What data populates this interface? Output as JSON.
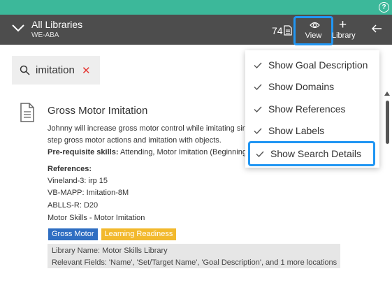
{
  "header": {
    "library_title": "All Libraries",
    "library_subtitle": "WE-ABA",
    "count": "74",
    "view_label": "View",
    "add_label": "Library"
  },
  "search": {
    "value": "imitation"
  },
  "item": {
    "title": "Gross Motor Imitation",
    "description_line1": "Johnny will increase gross motor control while imitating single-",
    "description_line2": "step gross motor actions and imitation with objects.",
    "prereq_label": "Pre-requisite skills:",
    "prereq_value": "Attending, Motor Imitation (Beginning)",
    "references_label": "References:",
    "references": [
      "Vineland-3: irp 15",
      "VB-MAPP: Imitation-8M",
      "ABLLS-R:  D20",
      "Motor Skills - Motor Imitation"
    ],
    "tags": [
      "Gross Motor",
      "Learning Readiness"
    ],
    "library_name": "Library Name: Motor Skills Library",
    "relevant_fields": "Relevant Fields: 'Name', 'Set/Target Name', 'Goal Description', and 1 more locations"
  },
  "view_menu": {
    "items": [
      "Show Goal Description",
      "Show Domains",
      "Show References",
      "Show Labels",
      "Show Search Details"
    ]
  },
  "colors": {
    "accent": "#3cb89a",
    "header_bg": "#4d4d4d",
    "highlight": "#2196f3",
    "tag_blue": "#2f6ec2",
    "tag_yellow": "#f2b92d",
    "clear_red": "#e53935"
  }
}
